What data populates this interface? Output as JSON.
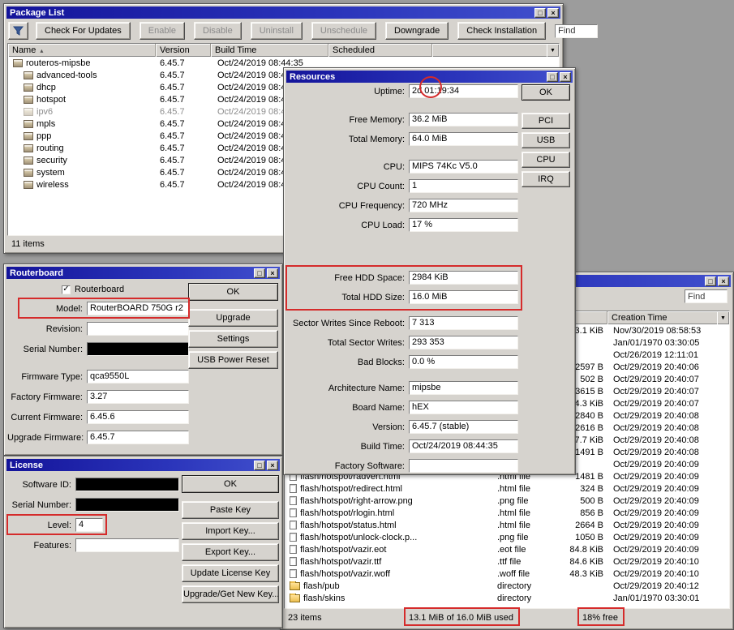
{
  "chrome": {
    "maximize": "□",
    "close": "×",
    "check": "✓",
    "sort": "▴",
    "dropdown": "▼"
  },
  "package_list": {
    "title": "Package List",
    "toolbar": {
      "buttons": [
        {
          "label": "Check For Updates",
          "enabled": true
        },
        {
          "label": "Enable",
          "enabled": false
        },
        {
          "label": "Disable",
          "enabled": false
        },
        {
          "label": "Uninstall",
          "enabled": false
        },
        {
          "label": "Unschedule",
          "enabled": false
        },
        {
          "label": "Downgrade",
          "enabled": true
        },
        {
          "label": "Check Installation",
          "enabled": true
        }
      ],
      "find_placeholder": "Find"
    },
    "columns": [
      "Name",
      "Version",
      "Build Time",
      "Scheduled"
    ],
    "rows": [
      {
        "name": "routeros-mipsbe",
        "version": "6.45.7",
        "build_time": "Oct/24/2019 08:44:35",
        "indent": 0,
        "disabled": false
      },
      {
        "name": "advanced-tools",
        "version": "6.45.7",
        "build_time": "Oct/24/2019 08:44:35",
        "indent": 1,
        "disabled": false
      },
      {
        "name": "dhcp",
        "version": "6.45.7",
        "build_time": "Oct/24/2019 08:44:35",
        "indent": 1,
        "disabled": false
      },
      {
        "name": "hotspot",
        "version": "6.45.7",
        "build_time": "Oct/24/2019 08:44:35",
        "indent": 1,
        "disabled": false
      },
      {
        "name": "ipv6",
        "version": "6.45.7",
        "build_time": "Oct/24/2019 08:44:35",
        "indent": 1,
        "disabled": true
      },
      {
        "name": "mpls",
        "version": "6.45.7",
        "build_time": "Oct/24/2019 08:44:35",
        "indent": 1,
        "disabled": false
      },
      {
        "name": "ppp",
        "version": "6.45.7",
        "build_time": "Oct/24/2019 08:44:35",
        "indent": 1,
        "disabled": false
      },
      {
        "name": "routing",
        "version": "6.45.7",
        "build_time": "Oct/24/2019 08:44:35",
        "indent": 1,
        "disabled": false
      },
      {
        "name": "security",
        "version": "6.45.7",
        "build_time": "Oct/24/2019 08:44:35",
        "indent": 1,
        "disabled": false
      },
      {
        "name": "system",
        "version": "6.45.7",
        "build_time": "Oct/24/2019 08:44:35",
        "indent": 1,
        "disabled": false
      },
      {
        "name": "wireless",
        "version": "6.45.7",
        "build_time": "Oct/24/2019 08:44:35",
        "indent": 1,
        "disabled": false
      }
    ],
    "status": "11 items"
  },
  "resources": {
    "title": "Resources",
    "groups": [
      [
        {
          "label": "Uptime:",
          "value": "2d 01:19:34"
        }
      ],
      [
        {
          "label": "Free Memory:",
          "value": "36.2 MiB"
        },
        {
          "label": "Total Memory:",
          "value": "64.0 MiB"
        }
      ],
      [
        {
          "label": "CPU:",
          "value": "MIPS 74Kc V5.0"
        },
        {
          "label": "CPU Count:",
          "value": "1"
        },
        {
          "label": "CPU Frequency:",
          "value": "720 MHz"
        },
        {
          "label": "CPU Load:",
          "value": "17 %"
        }
      ],
      [
        {
          "label": "Free HDD Space:",
          "value": "2984 KiB"
        },
        {
          "label": "Total HDD Size:",
          "value": "16.0 MiB"
        }
      ],
      [
        {
          "label": "Sector Writes Since Reboot:",
          "value": "7 313"
        },
        {
          "label": "Total Sector Writes:",
          "value": "293 353"
        },
        {
          "label": "Bad Blocks:",
          "value": "0.0 %"
        }
      ],
      [
        {
          "label": "Architecture Name:",
          "value": "mipsbe"
        },
        {
          "label": "Board Name:",
          "value": "hEX"
        },
        {
          "label": "Version:",
          "value": "6.45.7 (stable)"
        },
        {
          "label": "Build Time:",
          "value": "Oct/24/2019 08:44:35"
        },
        {
          "label": "Factory Software:",
          "value": ""
        }
      ]
    ],
    "buttons": [
      "OK",
      "PCI",
      "USB",
      "CPU",
      "IRQ"
    ]
  },
  "routerboard": {
    "title": "Routerboard",
    "checkbox_label": "Routerboard",
    "checked": true,
    "fields": [
      {
        "label": "Model:",
        "value": "RouterBOARD 750G r2"
      },
      {
        "label": "Revision:",
        "value": ""
      },
      {
        "label": "Serial Number:",
        "value": "",
        "redacted": true
      },
      {
        "label": "Firmware Type:",
        "value": "qca9550L",
        "gap_before": true
      },
      {
        "label": "Factory Firmware:",
        "value": "3.27"
      },
      {
        "label": "Current Firmware:",
        "value": "6.45.6"
      },
      {
        "label": "Upgrade Firmware:",
        "value": "6.45.7"
      }
    ],
    "buttons": [
      "OK",
      "Upgrade",
      "Settings",
      "USB Power Reset"
    ]
  },
  "license": {
    "title": "License",
    "fields": [
      {
        "label": "Software ID:",
        "value": "",
        "redacted": true
      },
      {
        "label": "Serial Number:",
        "value": "",
        "redacted": true
      },
      {
        "label": "Level:",
        "value": "4",
        "narrow": true
      },
      {
        "label": "Features:",
        "value": ""
      }
    ],
    "buttons": [
      "OK",
      "Paste Key",
      "Import Key...",
      "Export Key...",
      "Update License Key",
      "Upgrade/Get New Key..."
    ]
  },
  "file_list": {
    "title": "",
    "find_placeholder": "Find",
    "columns": {
      "file_name": "",
      "type": "",
      "size": "",
      "creation_time": "Creation Time"
    },
    "rows": [
      {
        "name": "",
        "type": "",
        "size": "3.1 KiB",
        "time": "Nov/30/2019 08:58:53",
        "kind": "hidden"
      },
      {
        "name": "",
        "type": "",
        "size": "",
        "time": "Jan/01/1970 03:30:05",
        "kind": "hidden"
      },
      {
        "name": "",
        "type": "",
        "size": "",
        "time": "Oct/26/2019 12:11:01",
        "kind": "hidden"
      },
      {
        "name": "",
        "type": "",
        "size": "2597 B",
        "time": "Oct/29/2019 20:40:06",
        "kind": "hidden"
      },
      {
        "name": "",
        "type": "",
        "size": "502 B",
        "time": "Oct/29/2019 20:40:07",
        "kind": "hidden"
      },
      {
        "name": "",
        "type": "",
        "size": "3615 B",
        "time": "Oct/29/2019 20:40:07",
        "kind": "hidden"
      },
      {
        "name": "",
        "type": "",
        "size": "4.3 KiB",
        "time": "Oct/29/2019 20:40:07",
        "kind": "hidden"
      },
      {
        "name": "",
        "type": "",
        "size": "2840 B",
        "time": "Oct/29/2019 20:40:08",
        "kind": "hidden"
      },
      {
        "name": "",
        "type": "",
        "size": "2616 B",
        "time": "Oct/29/2019 20:40:08",
        "kind": "hidden"
      },
      {
        "name": "",
        "type": "",
        "size": "7.7 KiB",
        "time": "Oct/29/2019 20:40:08",
        "kind": "hidden"
      },
      {
        "name": "",
        "type": "",
        "size": "1491 B",
        "time": "Oct/29/2019 20:40:08",
        "kind": "hidden"
      },
      {
        "name": "",
        "type": "",
        "size": "",
        "time": "Oct/29/2019 20:40:09",
        "kind": "hidden"
      },
      {
        "name": "flash/hotspot/radvert.html",
        "type": ".html file",
        "size": "1481 B",
        "time": "Oct/29/2019 20:40:09",
        "kind": "file"
      },
      {
        "name": "flash/hotspot/redirect.html",
        "type": ".html file",
        "size": "324 B",
        "time": "Oct/29/2019 20:40:09",
        "kind": "file"
      },
      {
        "name": "flash/hotspot/right-arrow.png",
        "type": ".png file",
        "size": "500 B",
        "time": "Oct/29/2019 20:40:09",
        "kind": "file"
      },
      {
        "name": "flash/hotspot/rlogin.html",
        "type": ".html file",
        "size": "856 B",
        "time": "Oct/29/2019 20:40:09",
        "kind": "file"
      },
      {
        "name": "flash/hotspot/status.html",
        "type": ".html file",
        "size": "2664 B",
        "time": "Oct/29/2019 20:40:09",
        "kind": "file"
      },
      {
        "name": "flash/hotspot/unlock-clock.p...",
        "type": ".png file",
        "size": "1050 B",
        "time": "Oct/29/2019 20:40:09",
        "kind": "file"
      },
      {
        "name": "flash/hotspot/vazir.eot",
        "type": ".eot file",
        "size": "84.8 KiB",
        "time": "Oct/29/2019 20:40:09",
        "kind": "file"
      },
      {
        "name": "flash/hotspot/vazir.ttf",
        "type": ".ttf file",
        "size": "84.6 KiB",
        "time": "Oct/29/2019 20:40:10",
        "kind": "file"
      },
      {
        "name": "flash/hotspot/vazir.woff",
        "type": ".woff file",
        "size": "48.3 KiB",
        "time": "Oct/29/2019 20:40:10",
        "kind": "file"
      },
      {
        "name": "flash/pub",
        "type": "directory",
        "size": "",
        "time": "Oct/29/2019 20:40:12",
        "kind": "dir"
      },
      {
        "name": "flash/skins",
        "type": "directory",
        "size": "",
        "time": "Jan/01/1970 03:30:01",
        "kind": "dir"
      }
    ],
    "status": {
      "items": "23 items",
      "used": "13.1 MiB of 16.0 MiB used",
      "free": "18% free"
    }
  }
}
